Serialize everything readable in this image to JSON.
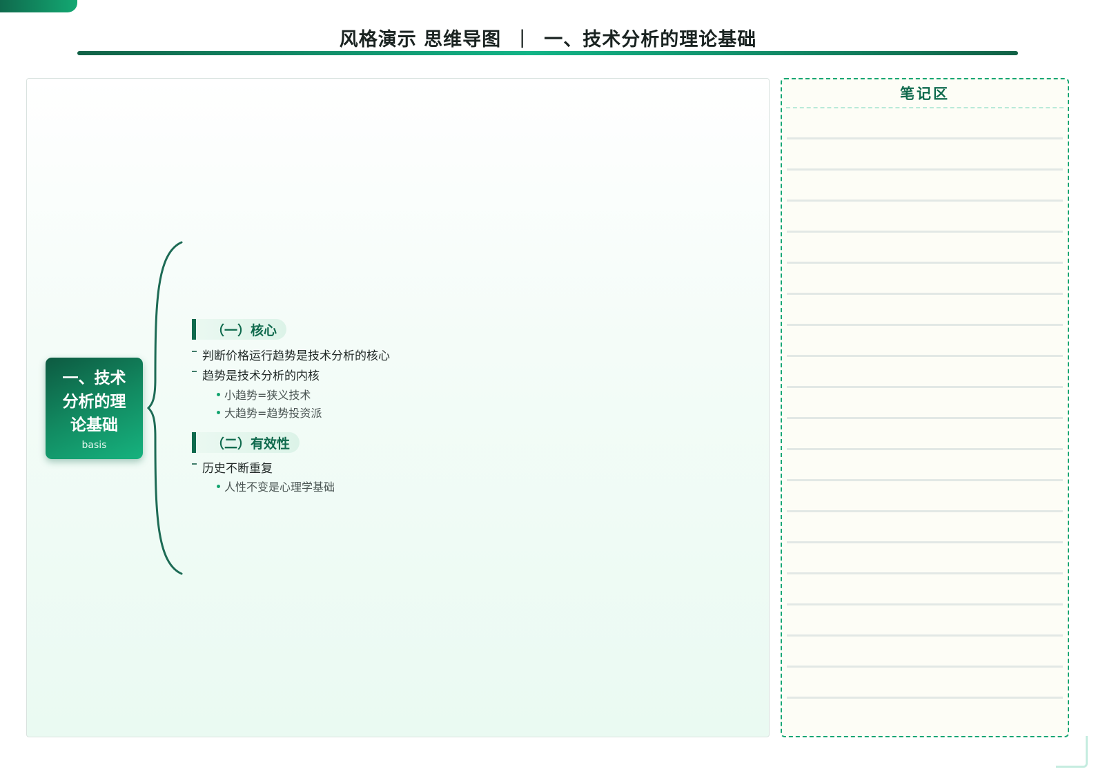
{
  "header": {
    "title_left": "风格演示 思维导图",
    "separator": "|",
    "title_right": "一、技术分析的理论基础"
  },
  "mindmap": {
    "root": {
      "title": "一、技术分析的理论基础",
      "subtitle": "basis"
    },
    "branches": [
      {
        "label": "（一）核心",
        "items": [
          {
            "text": "判断价格运行趋势是技术分析的核心",
            "children": []
          },
          {
            "text": "趋势是技术分析的内核",
            "children": [
              "小趋势=狭义技术",
              "大趋势=趋势投资派"
            ]
          }
        ]
      },
      {
        "label": "（二）有效性",
        "items": [
          {
            "text": "历史不断重复",
            "children": [
              "人性不变是心理学基础"
            ]
          }
        ]
      }
    ]
  },
  "notes": {
    "title": "笔记区"
  },
  "colors": {
    "brand_dark": "#0f6a4d",
    "brand_light": "#13a872",
    "notes_border": "#17a673",
    "notes_bg": "#fdfdf6"
  }
}
